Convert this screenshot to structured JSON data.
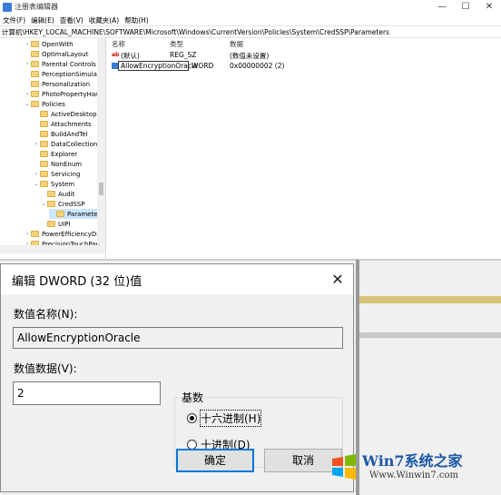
{
  "regedit": {
    "title": "注册表编辑器",
    "menu": [
      "文件(F)",
      "编辑(E)",
      "查看(V)",
      "收藏夹(A)",
      "帮助(H)"
    ],
    "address": "计算机\\HKEY_LOCAL_MACHINE\\SOFTWARE\\Microsoft\\Windows\\CurrentVersion\\Policies\\System\\CredSSP\\Parameters",
    "tree": [
      {
        "label": "OpenWith"
      },
      {
        "label": "OptimalLayout"
      },
      {
        "label": "Parental Controls"
      },
      {
        "label": "PerceptionSimulatio"
      },
      {
        "label": "Personalization"
      },
      {
        "label": "PhotoPropertyHandle"
      },
      {
        "label": "Policies"
      },
      {
        "label": "ActiveDesktop"
      },
      {
        "label": "Attachments"
      },
      {
        "label": "BuildAndTel"
      },
      {
        "label": "DataCollection"
      },
      {
        "label": "Explorer"
      },
      {
        "label": "NonEnum"
      },
      {
        "label": "Servicing"
      },
      {
        "label": "System"
      },
      {
        "label": "Audit"
      },
      {
        "label": "CredSSP"
      },
      {
        "label": "Parameters"
      },
      {
        "label": "UIPI"
      },
      {
        "label": "PowerEfficiencyDiagr"
      },
      {
        "label": "PrecisionTouchPad"
      }
    ],
    "columns": {
      "name": "名称",
      "type": "类型",
      "data": "数据"
    },
    "rows": [
      {
        "name": "(默认)",
        "type": "REG_SZ",
        "data": "(数值未设置)"
      },
      {
        "name": "AllowEncryptionOracle",
        "type": "WORD",
        "data": "0x00000002 (2)"
      }
    ]
  },
  "dialog": {
    "title": "编辑 DWORD (32 位)值",
    "close": "✕",
    "name_label": "数值名称(N):",
    "name_value": "AllowEncryptionOracle",
    "data_label": "数值数据(V):",
    "data_value": "2",
    "base_label": "基数",
    "hex_label": "十六进制(H)",
    "dec_label": "十进制(D)",
    "selected_base": "hex",
    "ok": "确定",
    "cancel": "取消"
  },
  "watermark": {
    "brand": "Win7系统之家",
    "url": "Www.Winwin7.com"
  }
}
